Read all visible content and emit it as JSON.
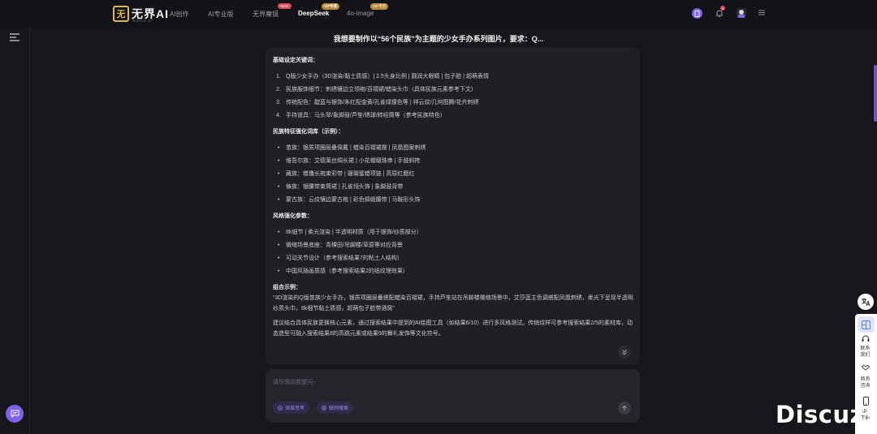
{
  "header": {
    "logo_text": "无界AI",
    "logo_sub": "WUJIE AI",
    "nav": [
      {
        "label": "AI创作"
      },
      {
        "label": "AI专业版"
      },
      {
        "label": "无界魔镜",
        "badge": "NEW"
      },
      {
        "label": "DeepSeek",
        "badge": "VIP专享",
        "active": true
      },
      {
        "label": "4o-image",
        "badge": "VIP专享"
      }
    ],
    "notification_count": "0",
    "icons": [
      "app-icon",
      "bell-icon",
      "avatar",
      "menu-icon"
    ]
  },
  "chat": {
    "title": "我想要制作以“56个民族”为主题的少女手办系列图片，要求：Q...",
    "sections": {
      "keywords": {
        "heading": "基础设定关键词：",
        "items": [
          "Q版少女手办（3D渲染/黏土质感）| 2.5头身比例 | 圆润大眼睛 | 包子脸 | 超萌表情",
          "民族服饰细节：刺绣镶边立领袍/百褶裙/蜡染头巾（具体民族元素参考下文）",
          "传统配色：靛蓝与银饰/朱红配金黄/孔雀绿撞色等 | 祥云纹/几何图腾/花卉刺绣",
          "手持道具：马头琴/象脚鼓/芦笙/绣球/转经筒等（参考民族特色）"
        ]
      },
      "ethnic": {
        "heading": "民族特征强化词库（示例）：",
        "items": [
          "苗族：银质项圈层叠佩戴 | 蜡染百褶裙摆 | 凤凰图案刺绣",
          "维吾尔族：艾德莱丝绸长裙 | 小花帽缀珠串 | 手鼓斜挎",
          "藏族：氆氇长袍束彩带 | 珊瑚蜜蜡项链 | 高原红腮红",
          "傣族：银腰带束筒裙 | 孔雀翎头饰 | 象脚鼓背带",
          "蒙古族：云纹镶边蒙古袍 | 彩色绸缎腰带 | 马鞍形头饰"
        ]
      },
      "style": {
        "heading": "风格强化参数：",
        "items": [
          "8k细节 | 柔光渲染 | 半透明材质（用于银饰/纱质部分）",
          "微缩场景底座：青稞田/吊脚楼/草原等对应背景",
          "可动关节设计（参考搜索结果7的粘土人结构）",
          "中国风插画质感（参考搜索结果2的纸纹理效果）"
        ]
      },
      "example": {
        "heading": "组合示例：",
        "text": "“3D渲染的Q版苗族少女手办，银质项圈层叠搭配蜡染百褶裙，手持芦笙站在吊脚楼微缩场景中，艾莎蓝主色调搭配凤凰刺绣，柔光下呈现半透明纱质头巾，8k细节黏土质感，超萌包子脸带酒窝”"
      },
      "final": "建议结合具体民族更换核心元素，通过搜索结果中提到的AI绘图工具（如结果6/10）进行多风格测试。传统纹样可参考搜索结果2/5的素材库，动态造型可融入搜索结果8的高跳元素或结果9的舞礼发饰等文化符号。"
    }
  },
  "input": {
    "placeholder": "请尽情向我提问~",
    "chips": [
      {
        "label": "深度思考"
      },
      {
        "label": "联网搜索"
      }
    ]
  },
  "side_panel": {
    "items": [
      {
        "label": "联系\n我们"
      },
      {
        "label": "商务\n咨询"
      },
      {
        "label": "APP\n下载"
      }
    ]
  },
  "watermark": "Discuz!",
  "colors": {
    "accent": "#7b62e6",
    "background": "#16171b",
    "card": "#1f2025",
    "new_badge": "#e04b5a",
    "vip_badge": "#b88a3a"
  }
}
